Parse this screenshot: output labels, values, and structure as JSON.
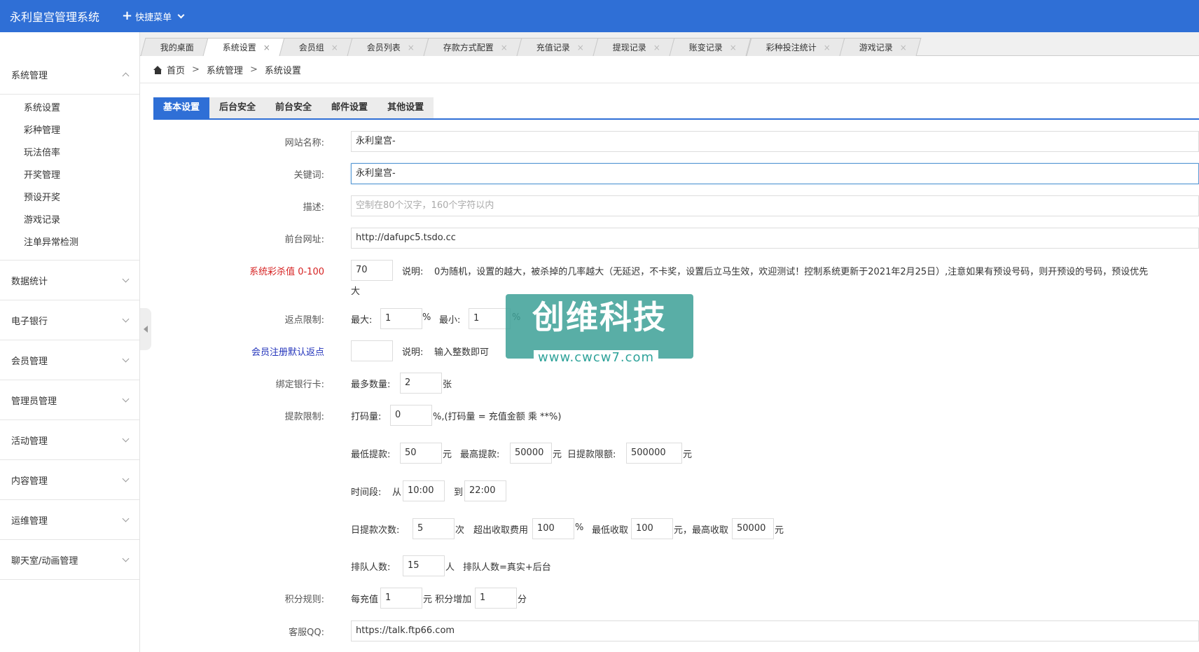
{
  "app": {
    "title": "永利皇宫管理系统",
    "quick_menu": "快捷菜单"
  },
  "sidebar": {
    "expanded_group": "系统管理",
    "sub_items": [
      "系统设置",
      "彩种管理",
      "玩法倍率",
      "开奖管理",
      "预设开奖",
      "游戏记录",
      "注单异常检测"
    ],
    "groups": [
      "数据统计",
      "电子银行",
      "会员管理",
      "管理员管理",
      "活动管理",
      "内容管理",
      "运维管理",
      "聊天室/动画管理"
    ]
  },
  "tabs": [
    {
      "label": "我的桌面"
    },
    {
      "label": "系统设置"
    },
    {
      "label": "会员组"
    },
    {
      "label": "会员列表"
    },
    {
      "label": "存款方式配置"
    },
    {
      "label": "充值记录"
    },
    {
      "label": "提现记录"
    },
    {
      "label": "账变记录"
    },
    {
      "label": "彩种投注统计"
    },
    {
      "label": "游戏记录"
    }
  ],
  "breadcrumb": {
    "home": "首页",
    "level1": "系统管理",
    "level2": "系统设置",
    "sep": ">"
  },
  "settings_tabs": [
    "基本设置",
    "后台安全",
    "前台安全",
    "邮件设置",
    "其他设置"
  ],
  "form": {
    "site_name": {
      "label": "网站名称:",
      "value": "永利皇宫-"
    },
    "keywords": {
      "label": "关键词:",
      "value": "永利皇宫-"
    },
    "description": {
      "label": "描述:",
      "placeholder": "空制在80个汉字，160个字符以内"
    },
    "front_url": {
      "label": "前台网址:",
      "value": "http://dafupc5.tsdo.cc"
    },
    "kill_rate": {
      "label": "系统彩杀值 0-100",
      "value": "70",
      "note_prefix": "说明:",
      "note": "0为随机，设置的越大，被杀掉的几率越大（无延迟，不卡奖，设置后立马生效，欢迎测试！控制系统更新于2021年2月25日）,注意如果有预设号码，则开预设的号码，预设优先",
      "note_wrap": "大"
    },
    "rebate_limit": {
      "label": "返点限制:",
      "max_label": "最大:",
      "max": "1",
      "pct": "%",
      "min_label": "最小:",
      "min": "1"
    },
    "member_rebate": {
      "label": "会员注册默认返点",
      "value": "",
      "note_prefix": "说明:",
      "note": "输入整数即可"
    },
    "bind_card": {
      "label": "绑定银行卡:",
      "max_label": "最多数量:",
      "value": "2",
      "unit": "张"
    },
    "withdraw": {
      "label": "提款限制:",
      "bet_label": "打码量:",
      "bet_value": "0",
      "bet_note": "%,(打码量 = 充值金额 乘 **%)",
      "min_label": "最低提款:",
      "min_value": "50",
      "yuan": "元",
      "max_label": "最高提款:",
      "max_value": "50000",
      "daily_label": "日提款限额:",
      "daily_value": "500000",
      "period_label": "时间段:",
      "from": "从",
      "from_value": "10:00",
      "to": "到",
      "to_value": "22:00",
      "count_label": "日提款次数:",
      "count_value": "5",
      "count_unit": "次",
      "fee_label": "超出收取费用",
      "fee_value": "100",
      "min_fee_label": "最低收取",
      "min_fee_value": "100",
      "max_fee_label": "元，最高收取",
      "max_fee_value": "50000",
      "queue_label": "排队人数:",
      "queue_value": "15",
      "queue_unit": "人",
      "queue_note": "排队人数=真实+后台"
    },
    "points": {
      "label": "积分规则:",
      "per_label": "每充值",
      "per_value": "1",
      "add_label": "元 积分增加",
      "add_value": "1",
      "unit": "分"
    },
    "qq": {
      "label": "客服QQ:",
      "value": "https://talk.ftp66.com"
    }
  },
  "watermark": {
    "title": "创维科技",
    "url": "www.cwcw7.com"
  },
  "colors": {
    "primary": "#2f6fd6",
    "danger": "#d62222",
    "link": "#2233bb"
  }
}
